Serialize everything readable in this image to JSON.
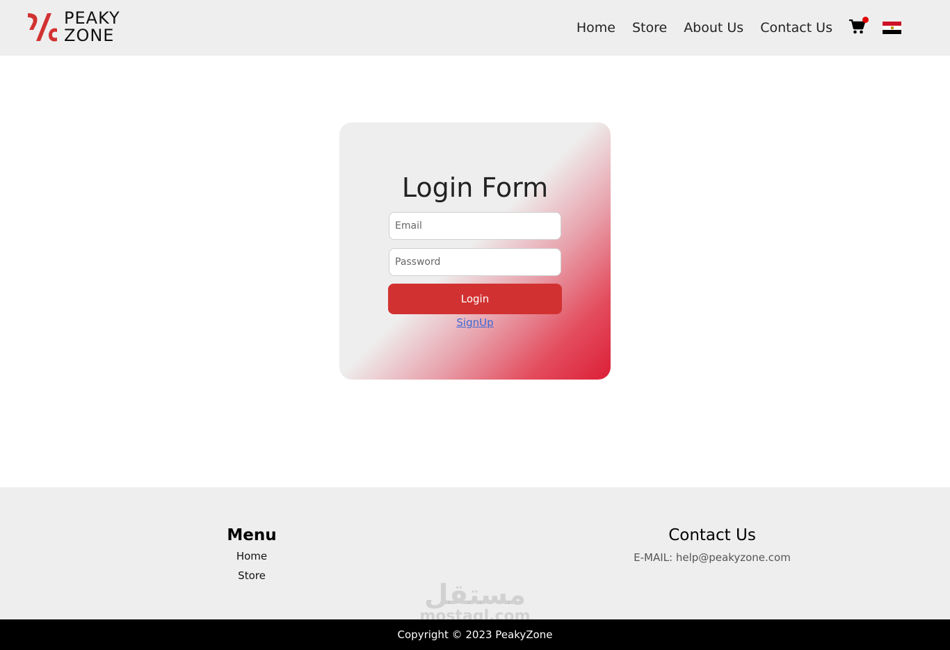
{
  "brand": {
    "name_line1": "PEAKY",
    "name_line2": "ZONE",
    "accent_color": "#d13231"
  },
  "nav": {
    "items": [
      {
        "label": "Home"
      },
      {
        "label": "Store"
      },
      {
        "label": "About Us"
      },
      {
        "label": "Contact Us"
      }
    ],
    "cart_icon": "shopping-cart-icon",
    "cart_badge_color": "#e00000",
    "flag_icon": "egypt-flag-icon"
  },
  "login": {
    "title": "Login Form",
    "email_placeholder": "Email",
    "password_placeholder": "Password",
    "login_label": "Login",
    "signup_label": "SignUp"
  },
  "footer": {
    "menu_title": "Menu",
    "menu_items": [
      {
        "label": "Home"
      },
      {
        "label": "Store"
      }
    ],
    "contact_title": "Contact Us",
    "contact_email": "E-MAIL: help@peakyzone.com",
    "watermark_arabic": "مستقل",
    "watermark_latin": "mostaql.com",
    "copyright": "Copyright © 2023 PeakyZone"
  }
}
